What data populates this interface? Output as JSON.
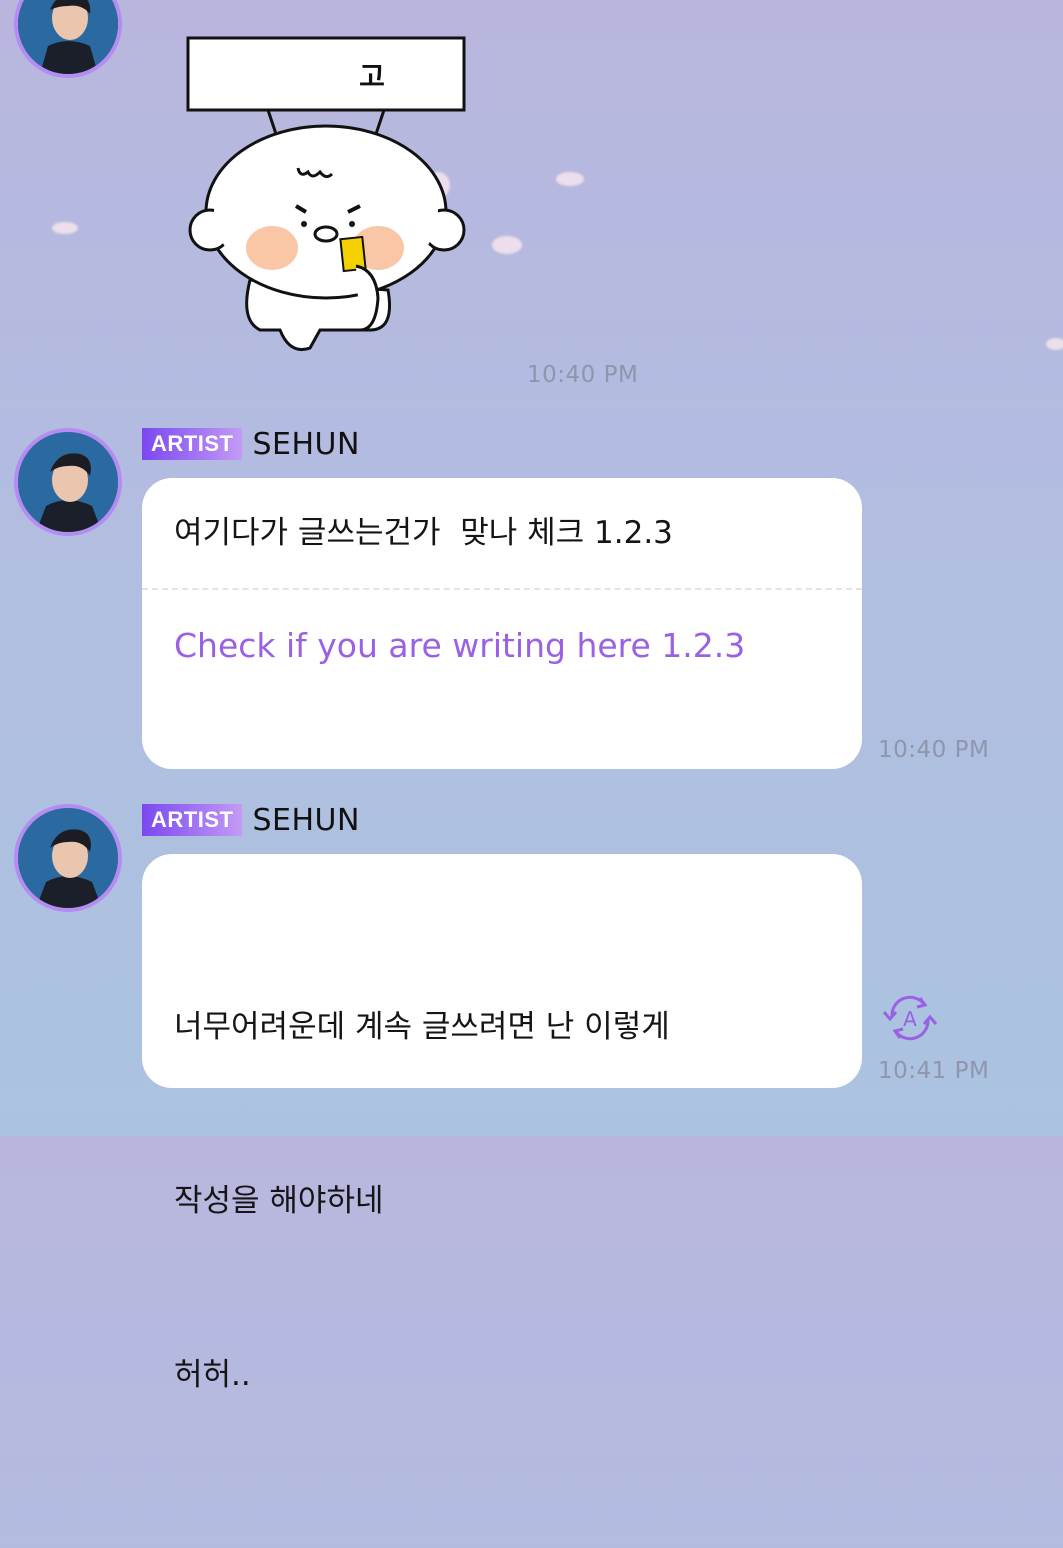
{
  "messages": [
    {
      "type": "sticker",
      "sticker_sign_text": "고",
      "time": "10:40 PM"
    },
    {
      "type": "text",
      "badge": "ARTIST",
      "sender": "SEHUN",
      "original": "여기다가 글쓰는건가  맞나 체크 1.2.3",
      "translation": "Check if you are writing here 1.2.3",
      "time": "10:40 PM"
    },
    {
      "type": "text",
      "badge": "ARTIST",
      "sender": "SEHUN",
      "original_lines": [
        "너무어려운데 계속 글쓰려면 난 이렇게",
        "작성을 해야하네",
        "허허.."
      ],
      "translate_icon": "translate-icon",
      "translate_glyph": "A",
      "time": "10:41 PM"
    }
  ],
  "colors": {
    "accent": "#9a62e3",
    "badge_start": "#7b48f0",
    "badge_end": "#c39af5",
    "avatar_ring": "#b48cf2"
  }
}
